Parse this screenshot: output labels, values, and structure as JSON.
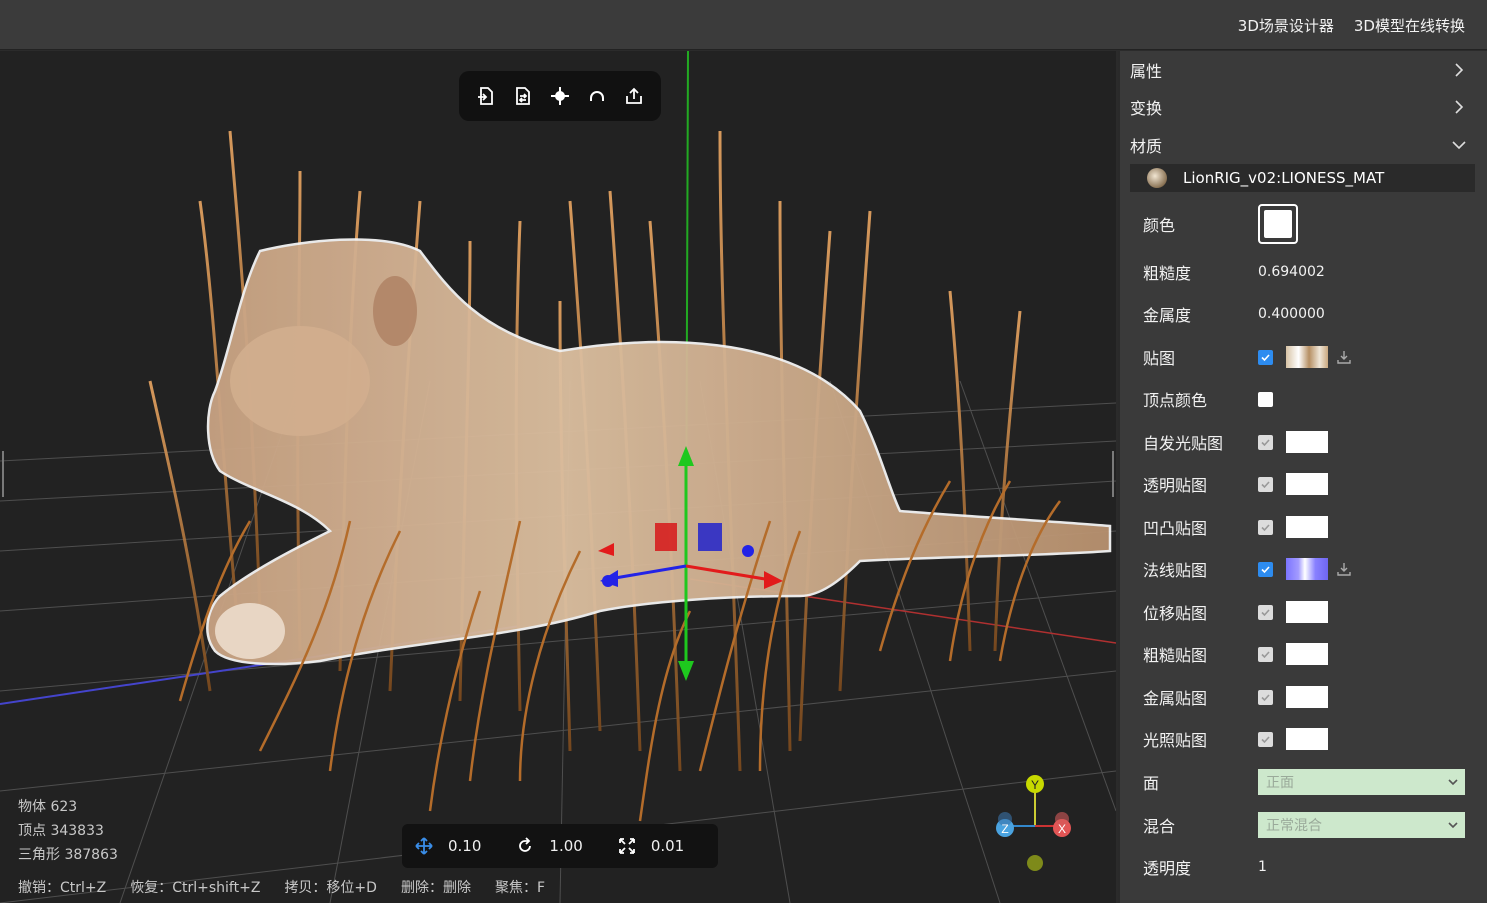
{
  "header": {
    "links": [
      "3D场景设计器",
      "3D模型在线转换"
    ]
  },
  "toolbar": {
    "tools": [
      "import-icon",
      "replace-icon",
      "focus-icon",
      "reset-icon",
      "export-icon"
    ]
  },
  "stats": {
    "objects": "物体 623",
    "vertices": "顶点 343833",
    "triangles": "三角形 387863"
  },
  "shortcuts": [
    "撤销：Ctrl+Z",
    "恢复：Ctrl+shift+Z",
    "拷贝：移位+D",
    "删除：删除",
    "聚焦：F"
  ],
  "transform": {
    "move": "0.10",
    "rotate": "1.00",
    "scale": "0.01"
  },
  "gizmo": {
    "y": "Y",
    "z": "Z",
    "x": "X"
  },
  "panel": {
    "sections": [
      "属性",
      "变换",
      "材质"
    ],
    "material_name": "LionRIG_v02:LIONESS_MAT",
    "props": {
      "color": "颜色",
      "roughness": "粗糙度",
      "roughness_val": "0.694002",
      "metalness": "金属度",
      "metalness_val": "0.400000",
      "map": "贴图",
      "vertex_color": "顶点颜色",
      "emissive_map": "自发光贴图",
      "alpha_map": "透明贴图",
      "bump_map": "凹凸贴图",
      "normal_map": "法线贴图",
      "displacement_map": "位移贴图",
      "roughness_map": "粗糙贴图",
      "metalness_map": "金属贴图",
      "light_map": "光照贴图",
      "side": "面",
      "side_val": "正面",
      "blending": "混合",
      "blending_val": "正常混合",
      "opacity": "透明度",
      "opacity_val": "1"
    }
  },
  "colors": {
    "accent": "#2d8cf0",
    "select_bg": "#cde8cc",
    "panel_bg": "#3a3a3a"
  }
}
